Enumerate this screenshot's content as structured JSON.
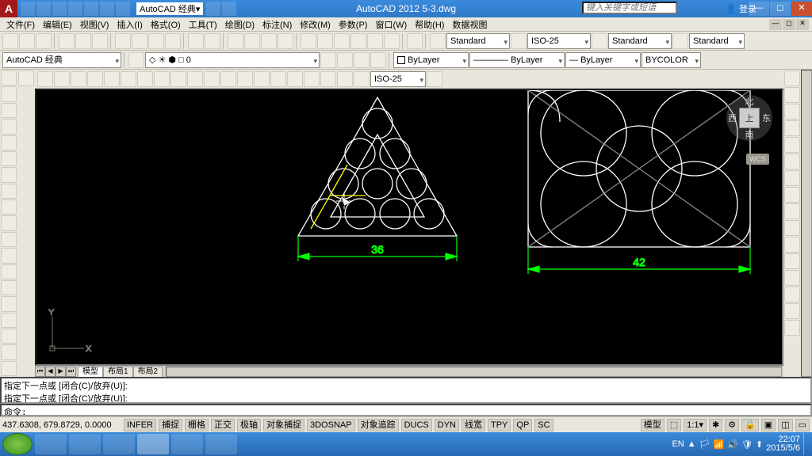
{
  "app": {
    "title": "AutoCAD 2012    5-3.dwg",
    "login": "登录",
    "logo": "A",
    "workspace": "AutoCAD 经典"
  },
  "search": {
    "placeholder": "键入关键字或短语"
  },
  "menu": {
    "file": "文件(F)",
    "edit": "编辑(E)",
    "view": "视图(V)",
    "insert": "插入(I)",
    "format": "格式(O)",
    "tools": "工具(T)",
    "draw": "绘图(D)",
    "dim": "标注(N)",
    "modify": "修改(M)",
    "param": "参数(P)",
    "window": "窗口(W)",
    "help": "帮助(H)",
    "data": "数据视图"
  },
  "styles": {
    "text": "Standard",
    "dim": "ISO-25",
    "table": "Standard",
    "ml": "Standard"
  },
  "layers": {
    "current": "0",
    "color": "ByLayer",
    "ltype": "ByLayer",
    "lweight": "ByLayer",
    "plot": "BYCOLOR"
  },
  "dimcombo": "ISO-25",
  "tabs": {
    "model": "模型",
    "layout1": "布局1",
    "layout2": "布局2"
  },
  "viewcube": {
    "n": "北",
    "s": "南",
    "e": "东",
    "w": "西",
    "top": "上",
    "wcs": "WCS"
  },
  "ucs": {
    "x": "X",
    "y": "Y"
  },
  "cmd": {
    "line1": "指定下一点或 [闭合(C)/放弃(U)]:",
    "line2": "指定下一点或 [闭合(C)/放弃(U)]:",
    "prompt": "命令:"
  },
  "status": {
    "coords": "437.6308, 679.8729, 0.0000",
    "infer": "INFER",
    "snap": "捕捉",
    "grid": "栅格",
    "ortho": "正交",
    "polar": "极轴",
    "osnap": "对象捕捉",
    "3dosnap": "3DOSNAP",
    "otrack": "对象追踪",
    "ducs": "DUCS",
    "dyn": "DYN",
    "lwt": "线宽",
    "tpy": "TPY",
    "qp": "QP",
    "sc": "SC",
    "model": "模型"
  },
  "tray": {
    "lang": "EN",
    "time": "22:07",
    "date": "2015/5/6"
  },
  "drawing": {
    "dim1": "36",
    "dim2": "42"
  },
  "wsrow": "AutoCAD 经典",
  "layer_sym": "◇ ☀ ⬢ □ 0"
}
